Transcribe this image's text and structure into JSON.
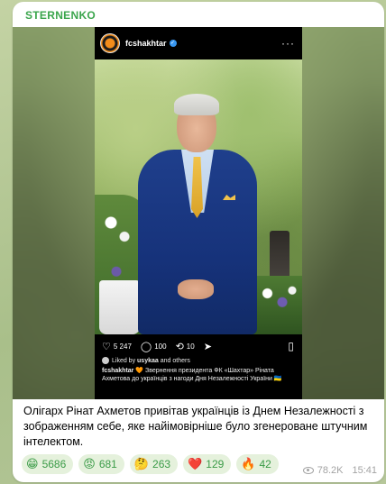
{
  "channel": {
    "name": "STERNENKO"
  },
  "instagram": {
    "username": "fcshakhtar",
    "more_icon": "ellipsis-icon",
    "likes": "5 247",
    "comments": "100",
    "reposts": "10",
    "liked_by_prefix": "Liked by",
    "liked_by_user": "usykaa",
    "liked_by_suffix": "and others",
    "caption_user": "fcshakhtar",
    "caption_text": "🧡 Звернення президента ФК «Шахтар» Ріната Ахметова до українців з нагоди Дня Незалежності України 🇺🇦"
  },
  "message": {
    "text": "Олігарх Рінат Ахметов привітав українців із Днем Незалежності з зображенням себе, яке найімовірніше було згенероване штучним інтелектом."
  },
  "reactions": [
    {
      "emoji": "😁",
      "count": "5686"
    },
    {
      "emoji": "😡",
      "count": "681"
    },
    {
      "emoji": "🤔",
      "count": "263"
    },
    {
      "emoji": "❤️",
      "count": "129"
    },
    {
      "emoji": "🔥",
      "count": "42"
    }
  ],
  "meta": {
    "views": "78.2K",
    "time": "15:41"
  },
  "colors": {
    "channel_name": "#3aa54c",
    "reaction_bg": "#e5f1dc",
    "reaction_text": "#3a9b47"
  }
}
